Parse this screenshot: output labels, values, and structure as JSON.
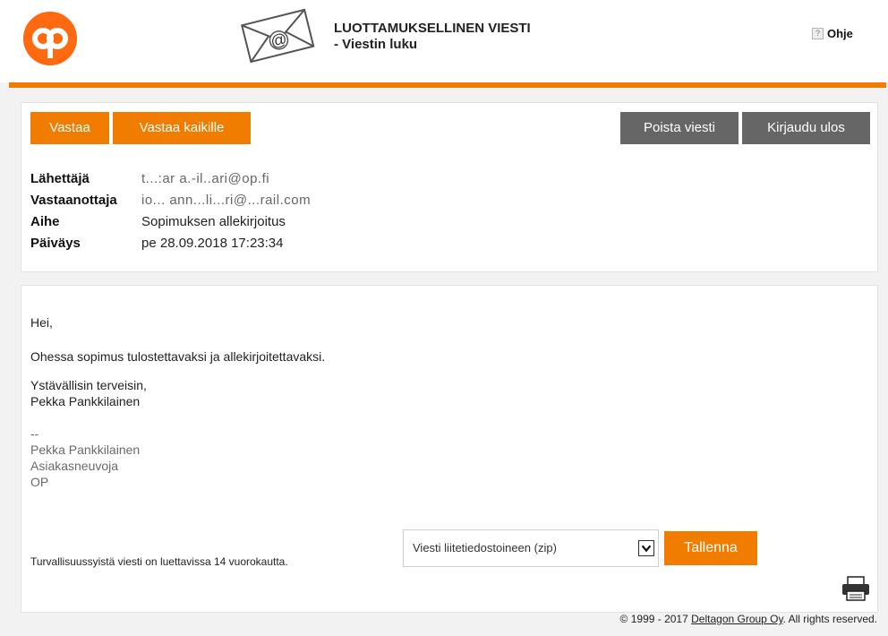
{
  "header": {
    "title_line1": "LUOTTAMUKSELLINEN VIESTI",
    "title_line2": "- Viestin luku",
    "help_label": "Ohje",
    "help_icon_glyph": "?"
  },
  "toolbar": {
    "reply_label": "Vastaa",
    "reply_all_label": "Vastaa kaikille",
    "delete_label": "Poista viesti",
    "logout_label": "Kirjaudu ulos"
  },
  "meta": {
    "sender_label": "Lähettäjä",
    "sender_value": "t...:ar a.-il..ari@op.fi",
    "recipient_label": "Vastaanottaja",
    "recipient_value": "io... ann...li...ri@...rail.com",
    "subject_label": "Aihe",
    "subject_value": "Sopimuksen allekirjoitus",
    "date_label": "Päiväys",
    "date_value": "pe 28.09.2018 17:23:34"
  },
  "message": {
    "greeting": "Hei,",
    "line1": "Ohessa sopimus tulostettavaksi ja allekirjoitettavaksi.",
    "closing": "Ystävällisin terveisin,",
    "closing_name": "Pekka Pankkilainen",
    "sig_sep": "--",
    "sig_name": "Pekka Pankkilainen",
    "sig_title": "Asiakasneuvoja",
    "sig_company": "OP"
  },
  "footer": {
    "security_note": "Turvallisuussyistä viesti on luettavissa 14 vuorokautta.",
    "download_selected": "Viesti liitetiedostoineen (zip)",
    "save_label": "Tallenna",
    "copyright_prefix": "© 1999 - 2017 ",
    "copyright_link": "Deltagon Group Oy",
    "copyright_suffix": ". All rights reserved."
  },
  "colors": {
    "brand_orange": "#f07d00",
    "button_gray": "#666666"
  },
  "icons": [
    "op-logo-icon",
    "envelope-at-icon",
    "help-icon",
    "chevron-down-icon",
    "printer-icon"
  ]
}
